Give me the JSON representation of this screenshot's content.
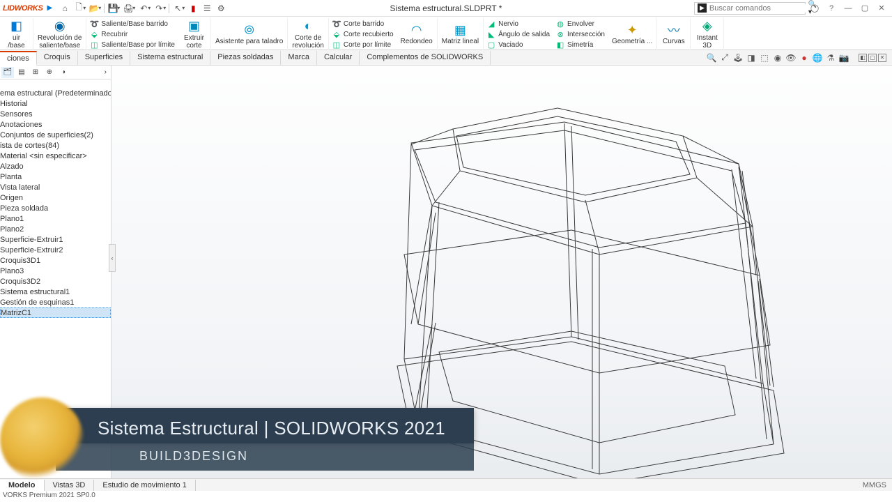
{
  "app_logo": "LIDWORKS",
  "document_title": "Sistema estructural.SLDPRT *",
  "search_placeholder": "Buscar comandos",
  "ribbon": {
    "revolve": {
      "line1": "uir",
      "line2": "/base"
    },
    "revolve2": {
      "line1": "Revolución de",
      "line2": "saliente/base"
    },
    "sweep_stack": [
      "Saliente/Base barrido",
      "Recubrir",
      "Saliente/Base por límite"
    ],
    "extrude": {
      "line1": "Extruir",
      "line2": "corte"
    },
    "wizard": "Asistente para taladro",
    "revolve_cut": {
      "line1": "Corte de",
      "line2": "revolución"
    },
    "cut_stack": [
      "Corte barrido",
      "Corte recubierto",
      "Corte por límite"
    ],
    "fillet": "Redondeo",
    "pattern": "Matriz lineal",
    "rib_stack": [
      "Nervio",
      "Ángulo de salida",
      "Vaciado"
    ],
    "wrap_stack": [
      "Envolver",
      "Intersección",
      "Simetría"
    ],
    "geometry": "Geometría ...",
    "curves": "Curvas",
    "instant3d": {
      "line1": "Instant",
      "line2": "3D"
    }
  },
  "tabs": [
    "ciones",
    "Croquis",
    "Superficies",
    "Sistema estructural",
    "Piezas soldadas",
    "Marca",
    "Calcular",
    "Complementos de SOLIDWORKS"
  ],
  "tree": [
    "ema estructural  (Predeterminado<",
    "Historial",
    "Sensores",
    "Anotaciones",
    "Conjuntos de superficies(2)",
    "ista de cortes(84)",
    "Material <sin especificar>",
    "Alzado",
    "Planta",
    "Vista lateral",
    "Origen",
    "Pieza soldada",
    "Plano1",
    "Plano2",
    "Superficie-Extruir1",
    "Superficie-Extruir2",
    "Croquis3D1",
    "Plano3",
    "Croquis3D2",
    "Sistema estructural1",
    "Gestión de esquinas1",
    "MatrizC1"
  ],
  "tree_selected_index": 21,
  "bottom_tabs": [
    "Modelo",
    "Vistas 3D",
    "Estudio de movimiento 1"
  ],
  "units": "MMGS",
  "status": "VORKS Premium 2021 SP0.0",
  "overlay": {
    "title": "Sistema Estructural | SOLIDWORKS 2021",
    "subtitle": "BUILD3DESIGN"
  }
}
